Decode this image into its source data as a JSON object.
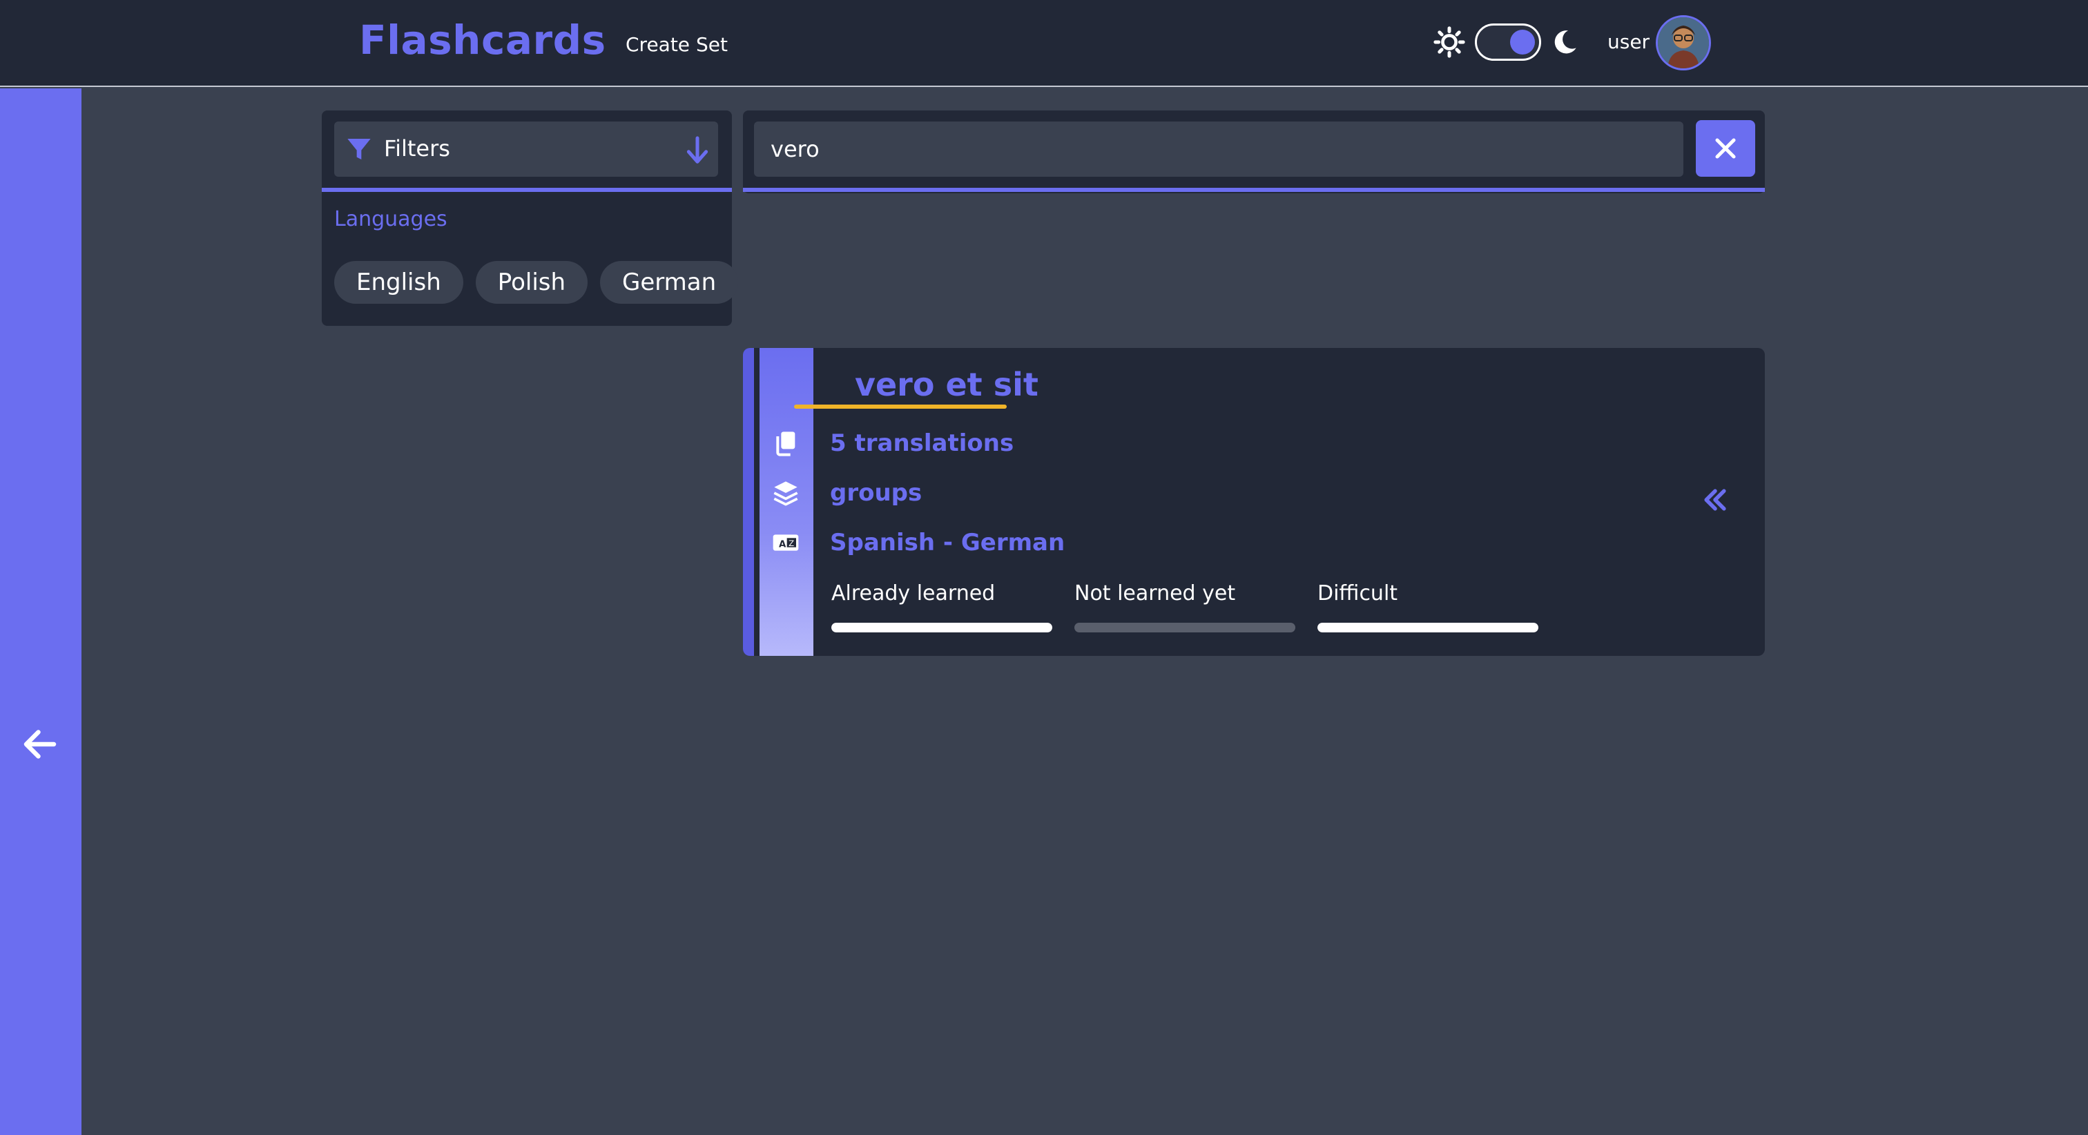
{
  "app": {
    "title": "Flashcards",
    "accent_color": "#6b6ef0",
    "highlight_color": "#f0b429"
  },
  "nav": {
    "create_set_label": "Create Set",
    "theme_toggle": {
      "mode": "dark",
      "sun_icon": "sun-icon",
      "moon_icon": "moon-icon"
    },
    "username": "user",
    "avatar_icon": "avatar"
  },
  "sidebar": {
    "back_icon": "arrow-left-icon"
  },
  "filters": {
    "label": "Filters",
    "filter_icon": "funnel-icon",
    "toggle_icon": "arrow-down-icon",
    "languages_title": "Languages",
    "languages": [
      "English",
      "Polish",
      "German"
    ]
  },
  "search": {
    "value": "vero",
    "placeholder": "",
    "clear_icon": "close-icon"
  },
  "results": [
    {
      "title": "vero et sit",
      "translations": "5 translations",
      "groups": "groups",
      "languages": "Spanish - German",
      "collapse_icon": "double-chevron-left-icon",
      "progress": [
        {
          "label": "Already learned",
          "value": 1.0
        },
        {
          "label": "Not learned yet",
          "value": 0.0
        },
        {
          "label": "Difficult",
          "value": 1.0
        }
      ]
    }
  ]
}
